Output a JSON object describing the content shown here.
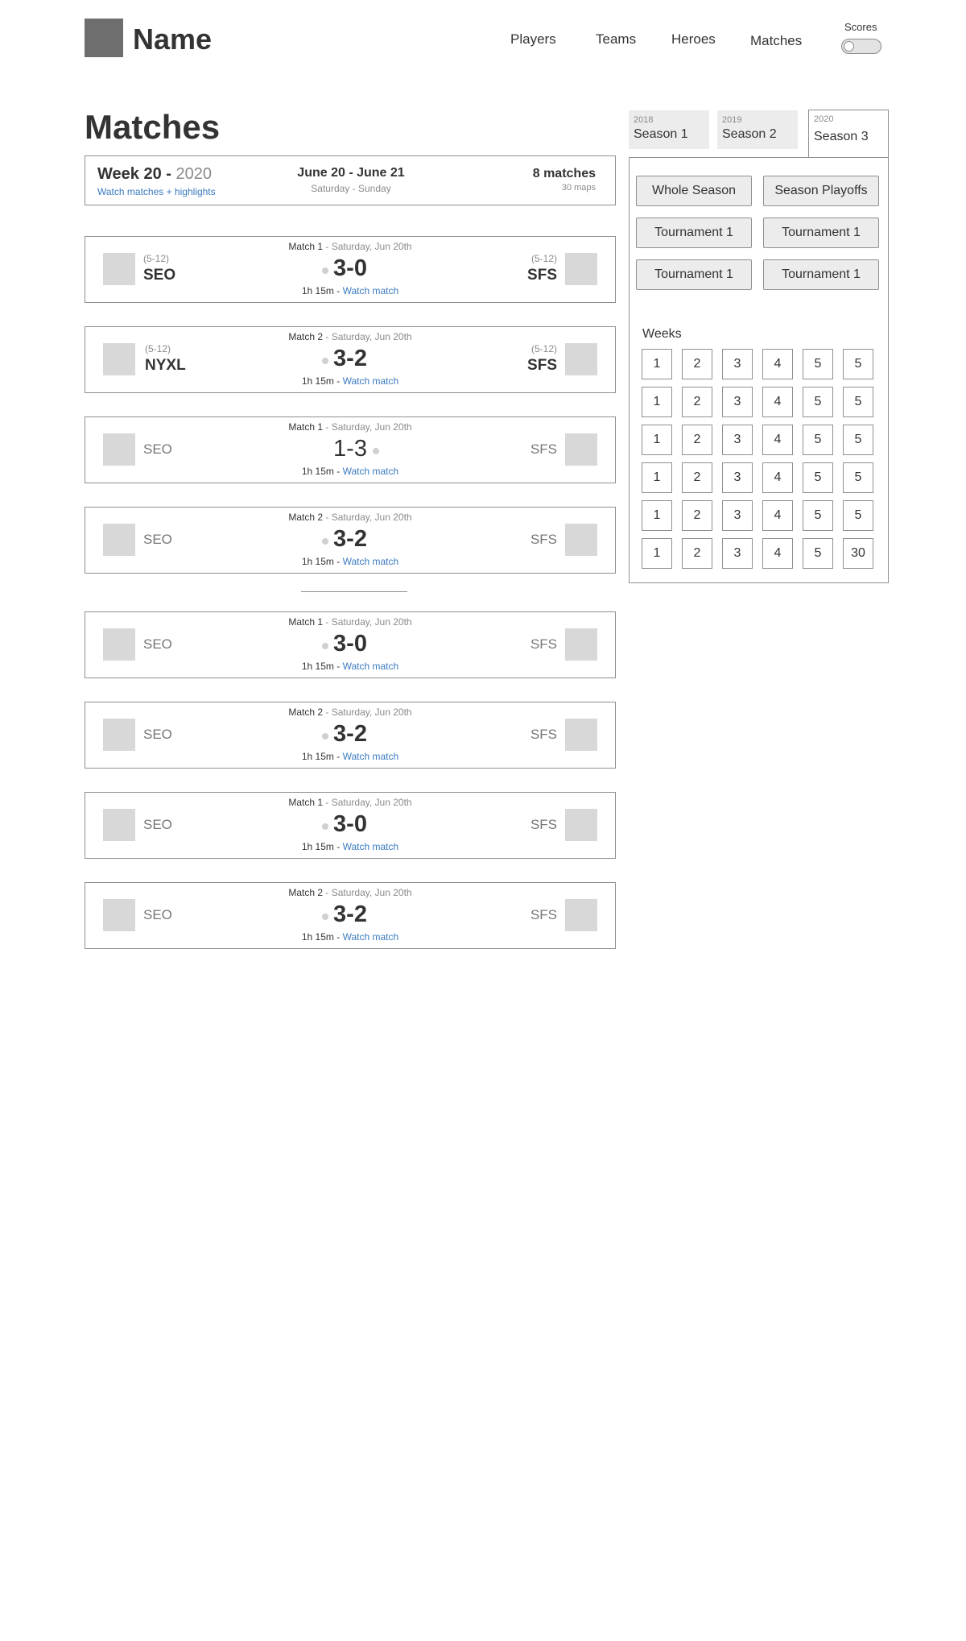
{
  "header": {
    "brand": "Name",
    "nav": [
      "Players",
      "Teams",
      "Heroes",
      "Matches"
    ],
    "scores_label": "Scores",
    "scores_toggle_on": false
  },
  "page_title": "Matches",
  "week_summary": {
    "title": "Week 20 -",
    "year": "2020",
    "link": "Watch matches + highlights",
    "dates": "June 20 - June 21",
    "days": "Saturday - Sunday",
    "matches": "8 matches",
    "maps": "30 maps"
  },
  "matches": [
    {
      "label": "Match 1",
      "date": "Saturday, Jun 20th",
      "left_record": "(5-12)",
      "left_team": "SEO",
      "right_record": "(5-12)",
      "right_team": "SFS",
      "score": "3-0",
      "duration": "1h 15m -",
      "watch": "Watch match"
    },
    {
      "label": "Match 2",
      "date": "Saturday, Jun 20th",
      "left_record": "(5-12)",
      "left_team": "NYXL",
      "right_record": "(5-12)",
      "right_team": "SFS",
      "score": "3-2",
      "duration": "1h 15m -",
      "watch": "Watch match"
    },
    {
      "label": "Match 1",
      "date": "Saturday, Jun 20th",
      "left_team": "SEO",
      "right_team": "SFS",
      "score": "1-3",
      "duration": "1h 15m -",
      "watch": "Watch match"
    },
    {
      "label": "Match 2",
      "date": "Saturday, Jun 20th",
      "left_team": "SEO",
      "right_team": "SFS",
      "score": "3-2",
      "duration": "1h 15m -",
      "watch": "Watch match"
    },
    {
      "label": "Match 1",
      "date": "Saturday, Jun 20th",
      "left_team": "SEO",
      "right_team": "SFS",
      "score": "3-0",
      "duration": "1h 15m -",
      "watch": "Watch match"
    },
    {
      "label": "Match 2",
      "date": "Saturday, Jun 20th",
      "left_team": "SEO",
      "right_team": "SFS",
      "score": "3-2",
      "duration": "1h 15m -",
      "watch": "Watch match"
    },
    {
      "label": "Match 1",
      "date": "Saturday, Jun 20th",
      "left_team": "SEO",
      "right_team": "SFS",
      "score": "3-0",
      "duration": "1h 15m -",
      "watch": "Watch match"
    },
    {
      "label": "Match 2",
      "date": "Saturday, Jun 20th",
      "left_team": "SEO",
      "right_team": "SFS",
      "score": "3-2",
      "duration": "1h 15m -",
      "watch": "Watch match"
    }
  ],
  "seasons": [
    {
      "year": "2018",
      "name": "Season 1"
    },
    {
      "year": "2019",
      "name": "Season 2"
    },
    {
      "year": "2020",
      "name": "Season 3"
    }
  ],
  "filters": [
    "Whole Season",
    "Season Playoffs",
    "Tournament 1",
    "Tournament 1",
    "Tournament 1",
    "Tournament 1"
  ],
  "weeks_label": "Weeks",
  "weeks": [
    [
      "1",
      "2",
      "3",
      "4",
      "5",
      "5"
    ],
    [
      "1",
      "2",
      "3",
      "4",
      "5",
      "5"
    ],
    [
      "1",
      "2",
      "3",
      "4",
      "5",
      "5"
    ],
    [
      "1",
      "2",
      "3",
      "4",
      "5",
      "5"
    ],
    [
      "1",
      "2",
      "3",
      "4",
      "5",
      "5"
    ],
    [
      "1",
      "2",
      "3",
      "4",
      "5",
      "30"
    ]
  ],
  "colors": {
    "link": "#3a7abf",
    "muted": "#8a8a8a",
    "placeholder": "#d8d8d8",
    "logo": "#6e6e6e",
    "border": "#8f8f8f"
  }
}
